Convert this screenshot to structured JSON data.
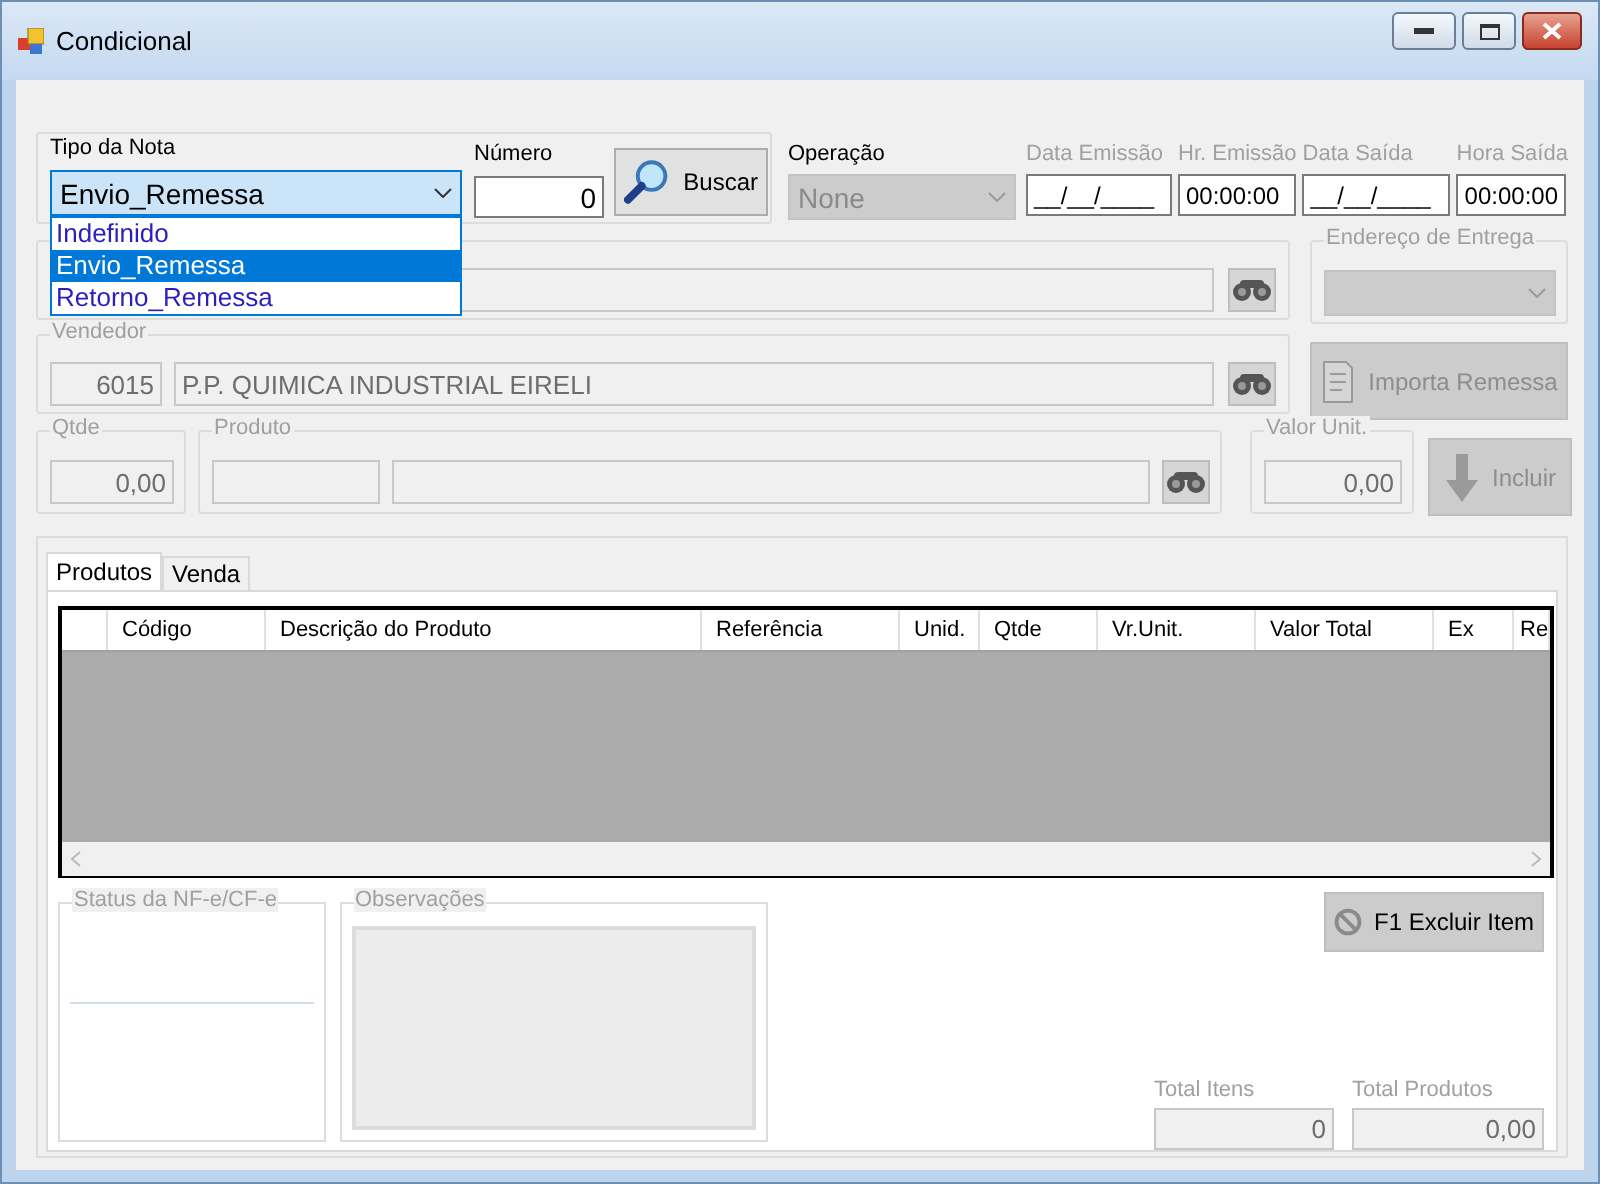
{
  "window": {
    "title": "Condicional"
  },
  "tipo_nota": {
    "label": "Tipo da Nota",
    "value": "Envio_Remessa",
    "expanded": true,
    "options": [
      {
        "label": "Indefinido",
        "selected": false
      },
      {
        "label": "Envio_Remessa",
        "selected": true
      },
      {
        "label": "Retorno_Remessa",
        "selected": false
      }
    ]
  },
  "numero": {
    "label": "Número",
    "value": "0"
  },
  "buscar_button": "Buscar",
  "operacao": {
    "label": "Operação",
    "value": "None",
    "disabled": true
  },
  "time_fields": [
    {
      "label": "Data Emissão",
      "value": "__/__/____"
    },
    {
      "label": "Hr. Emissão",
      "value": "00:00:00"
    },
    {
      "label": "Data Saída",
      "value": "__/__/____"
    },
    {
      "label": "Hora Saída",
      "value": "00:00:00"
    }
  ],
  "endereco_entrega": {
    "label": "Endereço de Entrega",
    "disabled": true
  },
  "vendedor": {
    "label": "Vendedor",
    "code": "6015",
    "name": "P.P. QUIMICA INDUSTRIAL EIRELI"
  },
  "importa_button": {
    "label": "Importa Remessa",
    "disabled": true
  },
  "qtde": {
    "label": "Qtde",
    "value": "0,00"
  },
  "produto": {
    "label": "Produto"
  },
  "valor_unit": {
    "label": "Valor Unit.",
    "value": "0,00"
  },
  "incluir_button": {
    "label": "Incluir",
    "disabled": true
  },
  "tabs": [
    {
      "label": "Produtos",
      "selected": true
    },
    {
      "label": "Venda",
      "selected": false
    }
  ],
  "table": {
    "columns": [
      "Código",
      "Descrição do Produto",
      "Referência",
      "Unid.",
      "Qtde",
      "Vr.Unit.",
      "Valor Total",
      "Ex",
      "Re"
    ]
  },
  "status": {
    "label": "Status da NF-e/CF-e"
  },
  "observacoes": {
    "label": "Observações"
  },
  "excluir_button": "F1 Excluir Item",
  "totals": [
    {
      "label": "Total Itens",
      "value": "0"
    },
    {
      "label": "Total Produtos",
      "value": "0,00"
    }
  ]
}
